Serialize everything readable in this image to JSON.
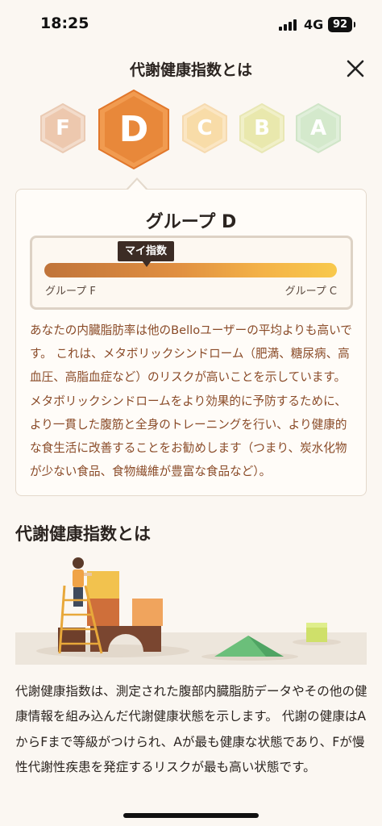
{
  "status_bar": {
    "time": "18:25",
    "network": "4G",
    "battery": "92"
  },
  "header": {
    "title": "代謝健康指数とは",
    "close_icon": "close-icon"
  },
  "grades": [
    {
      "letter": "F",
      "color": "#e9b79a",
      "selected": false
    },
    {
      "letter": "D",
      "color": "#e8883a",
      "selected": true
    },
    {
      "letter": "C",
      "color": "#f6d39a",
      "selected": false
    },
    {
      "letter": "B",
      "color": "#e7e6a5",
      "selected": false
    },
    {
      "letter": "A",
      "color": "#cfe6c7",
      "selected": false
    }
  ],
  "card": {
    "title": "グループ D",
    "gauge": {
      "marker_label": "マイ指数",
      "left_label": "グループ F",
      "right_label": "グループ C",
      "marker_position": 0.35
    },
    "description": "あなたの内臓脂肪率は他のBelloユーザーの平均よりも高いです。 これは、メタボリックシンドローム（肥満、糖尿病、高血圧、高脂血症など）のリスクが高いことを示しています。 メタボリックシンドロームをより効果的に予防するために、より一貫した腹筋と全身のトレーニングを行い、より健康的な食生活に改善することをお勧めします（つまり、炭水化物が少ない食品、食物繊維が豊富な食品など）。"
  },
  "section": {
    "title": "代謝健康指数とは",
    "body": "代謝健康指数は、測定された腹部内臓脂肪データやその他の健康情報を組み込んだ代謝健康状態を示します。 代謝の健康はAからFまで等級がつけられ、Aが最も健康な状態であり、Fが慢性代謝性疾患を発症するリスクが最も高い状態です。"
  },
  "colors": {
    "accent": "#e8883a",
    "text_brown": "#8a4b28",
    "background": "#fbf7f2"
  }
}
